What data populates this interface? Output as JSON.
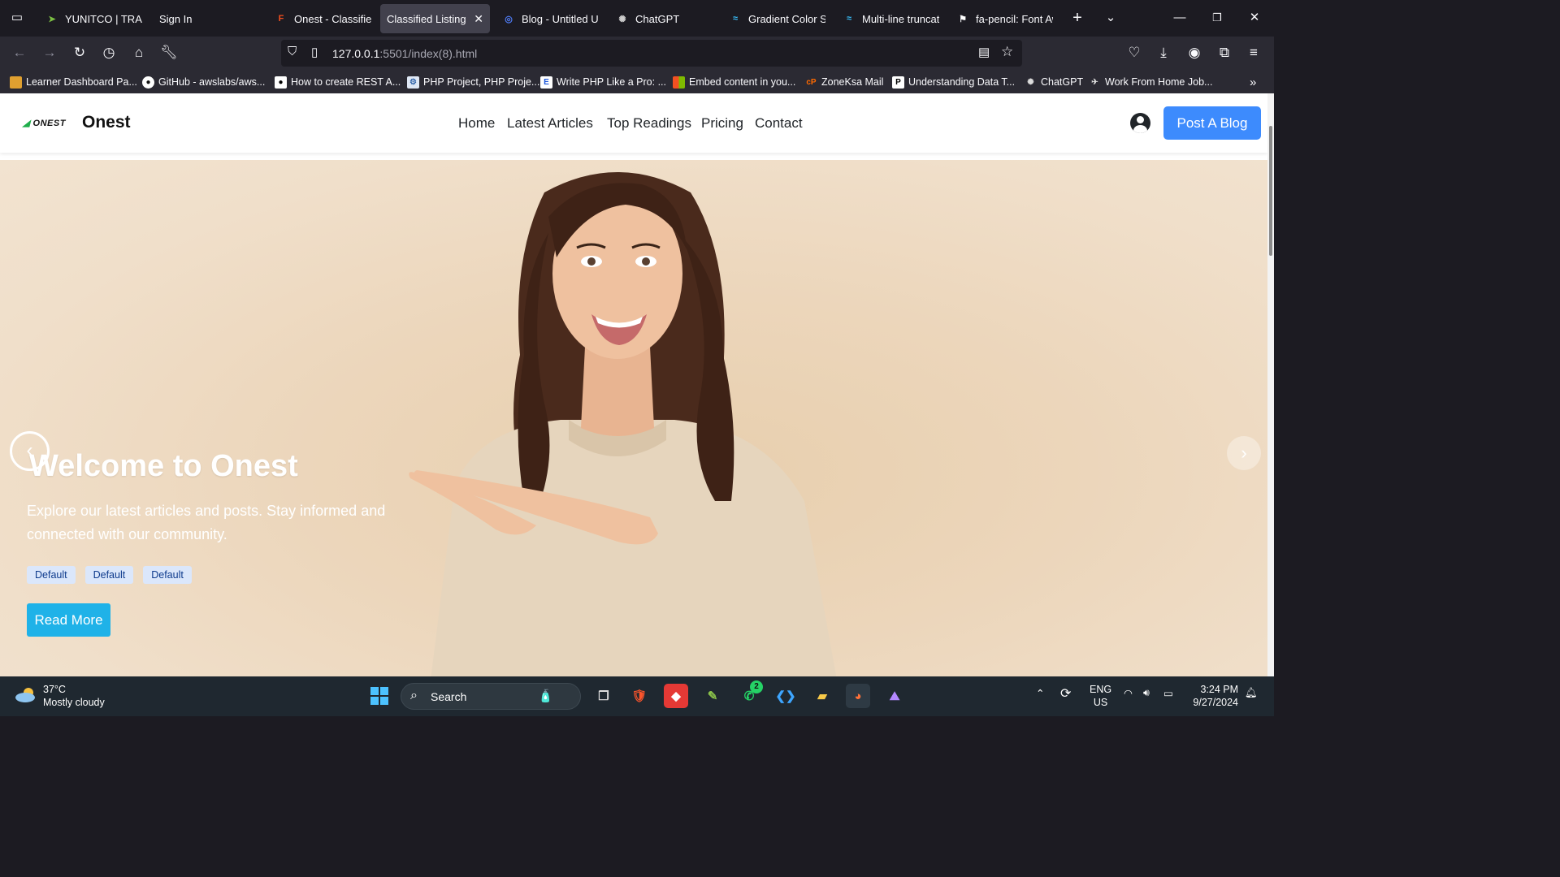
{
  "browser": {
    "tabs": [
      {
        "title": "YUNITCO | TRANS"
      },
      {
        "title": "Sign In"
      },
      {
        "title": "Onest - Classified"
      },
      {
        "title": "Classified Listing",
        "active": true
      },
      {
        "title": "Blog - Untitled UI"
      },
      {
        "title": "ChatGPT"
      },
      {
        "title": "Gradient Color St"
      },
      {
        "title": "Multi-line truncati"
      },
      {
        "title": "fa-pencil: Font Aw"
      }
    ],
    "url_host": "127.0.0.1",
    "url_path": ":5501/index(8).html",
    "bookmarks": [
      {
        "label": "Learner Dashboard Pa..."
      },
      {
        "label": "GitHub - awslabs/aws..."
      },
      {
        "label": "How to create REST A..."
      },
      {
        "label": "PHP Project, PHP Proje..."
      },
      {
        "label": "Write PHP Like a Pro: ..."
      },
      {
        "label": "Embed content in you..."
      },
      {
        "label": "ZoneKsa Mail"
      },
      {
        "label": "Understanding Data T..."
      },
      {
        "label": "ChatGPT"
      },
      {
        "label": "Work From Home Job..."
      }
    ]
  },
  "site": {
    "logo_text": "ONEST",
    "brand": "Onest",
    "nav": [
      "Home",
      "Latest Articles",
      "Top Readings",
      "Pricing",
      "Contact"
    ],
    "cta": "Post A Blog"
  },
  "hero": {
    "title": "Welcome to Onest",
    "subtitle": "Explore our latest articles and posts. Stay informed and connected with our community.",
    "badges": [
      "Default",
      "Default",
      "Default"
    ],
    "button": "Read More"
  },
  "taskbar": {
    "temperature": "37°C",
    "weather": "Mostly cloudy",
    "search_label": "Search",
    "whatsapp_badge": "2",
    "lang_line1": "ENG",
    "lang_line2": "US",
    "time": "3:24 PM",
    "date": "9/27/2024"
  },
  "colors": {
    "accent_blue": "#3d8bfd",
    "read_more": "#1fb2e8",
    "hero_bg": "#ecd6bb"
  }
}
